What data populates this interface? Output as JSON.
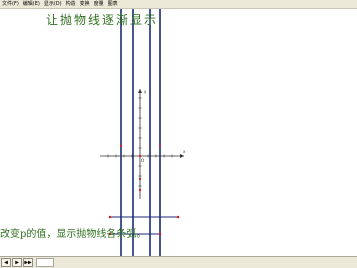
{
  "menubar": {
    "items": [
      "文件(F)",
      "编辑(E)",
      "显示(D)",
      "构造",
      "变换",
      "度量",
      "图表"
    ]
  },
  "canvas": {
    "title": "让抛物线逐渐显示",
    "caption": "改变p的值，显示抛物线各条弧。"
  },
  "axes": {
    "x_label": "x",
    "y_label": "y",
    "origin_label": "O"
  },
  "statusbar": {
    "buttons": [
      "◀",
      "▶",
      "▶▶"
    ]
  },
  "colors": {
    "vertical_lines": "#1a2a7a",
    "text": "#2f6f1f",
    "points": "#c62828"
  }
}
